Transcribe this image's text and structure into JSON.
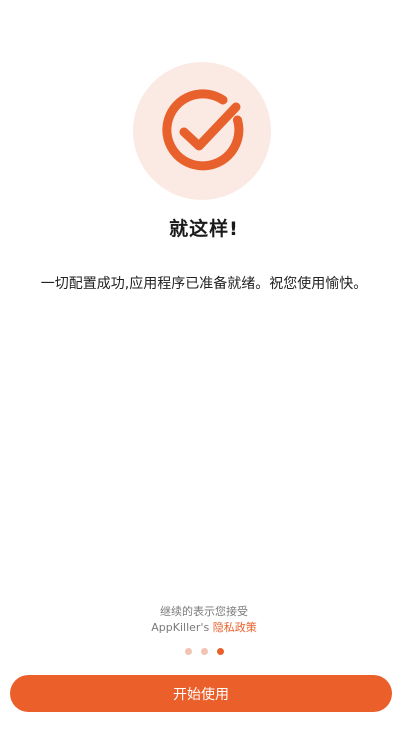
{
  "hero": {
    "icon": "check-circle-icon",
    "accent": "#e8602c",
    "background": "#fbeae4"
  },
  "title": "就这样!",
  "message": "一切配置成功,应用程序已准备就绪。祝您使用愉快。",
  "footer": {
    "line1": "继续的表示您接受",
    "app_name": "AppKiller's",
    "policy_link": "隐私政策"
  },
  "pagination": {
    "total": 3,
    "active_index": 3
  },
  "start_button": {
    "label": "开始使用",
    "color": "#ea5f2a"
  }
}
